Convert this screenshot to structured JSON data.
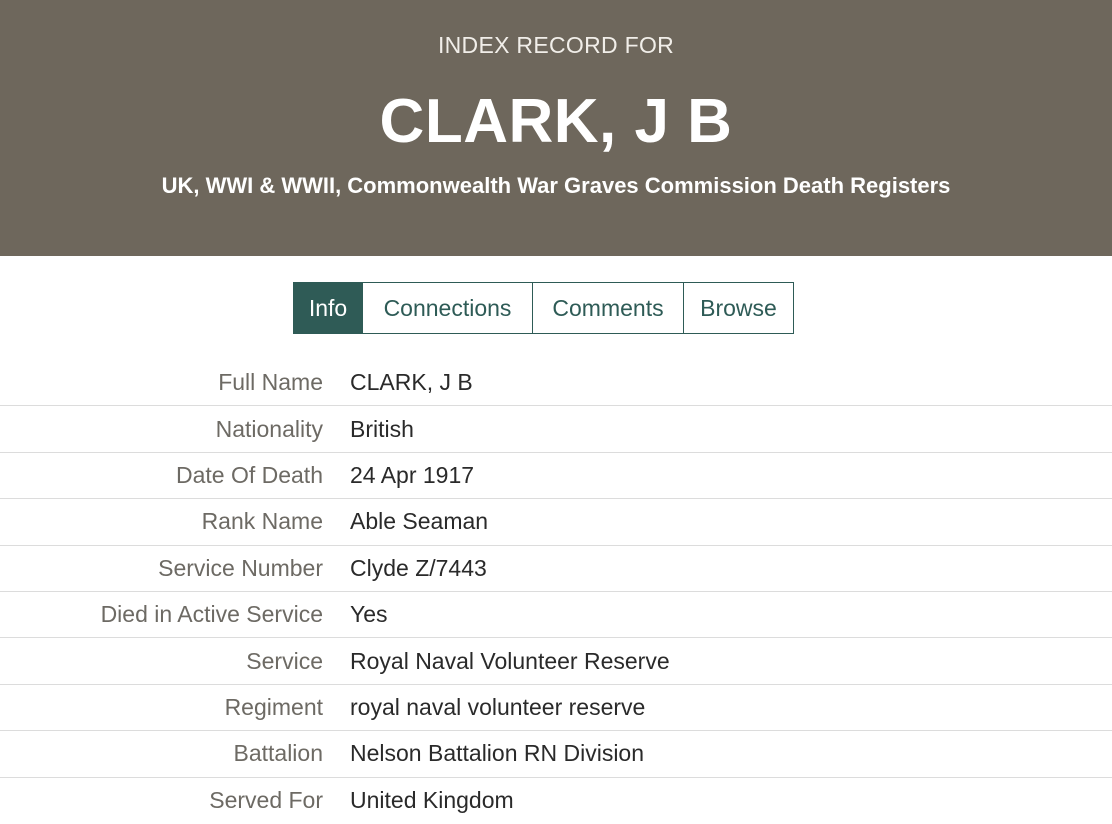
{
  "header": {
    "kicker": "INDEX RECORD FOR",
    "name": "CLARK, J B",
    "collection": "UK, WWI & WWII, Commonwealth War Graves Commission Death Registers",
    "background_color": "#6e675c"
  },
  "tabs": [
    {
      "label": "Info",
      "active": true
    },
    {
      "label": "Connections",
      "active": false
    },
    {
      "label": "Comments",
      "active": false
    },
    {
      "label": "Browse",
      "active": false
    }
  ],
  "accent_color": "#2f5b56",
  "details": [
    {
      "label": "Full Name",
      "value": "CLARK, J B"
    },
    {
      "label": "Nationality",
      "value": "British"
    },
    {
      "label": "Date Of Death",
      "value": "24 Apr 1917"
    },
    {
      "label": "Rank Name",
      "value": "Able Seaman"
    },
    {
      "label": "Service Number",
      "value": "Clyde Z/7443"
    },
    {
      "label": "Died in Active Service",
      "value": "Yes"
    },
    {
      "label": "Service",
      "value": "Royal Naval Volunteer Reserve"
    },
    {
      "label": "Regiment",
      "value": "royal naval volunteer reserve"
    },
    {
      "label": "Battalion",
      "value": "Nelson Battalion RN Division"
    },
    {
      "label": "Served For",
      "value": "United Kingdom"
    }
  ]
}
